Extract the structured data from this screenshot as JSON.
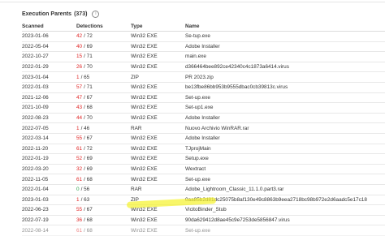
{
  "section": {
    "title": "Execution Parents",
    "count": "(373)",
    "info_icon": "info-icon"
  },
  "columns": {
    "scanned": "Scanned",
    "detections": "Detections",
    "type": "Type",
    "name": "Name"
  },
  "rows": [
    {
      "scanned": "2023-01-06",
      "det": "42",
      "total": "/ 72",
      "color": "red",
      "type": "Win32 EXE",
      "name": "Se-tup.exe"
    },
    {
      "scanned": "2022-05-04",
      "det": "40",
      "total": "/ 69",
      "color": "red",
      "type": "Win32 EXE",
      "name": "Adobe Installer"
    },
    {
      "scanned": "2022-10-27",
      "det": "15",
      "total": "/ 71",
      "color": "red",
      "type": "Win32 EXE",
      "name": "main.exe"
    },
    {
      "scanned": "2022-01-29",
      "det": "26",
      "total": "/ 70",
      "color": "red",
      "type": "Win32 EXE",
      "name": "d366464bee892ce42340c4c1873a6414.virus"
    },
    {
      "scanned": "2023-01-04",
      "det": "1",
      "total": "/ 65",
      "color": "red",
      "type": "ZIP",
      "name": "PR 2023.zip"
    },
    {
      "scanned": "2022-01-03",
      "det": "57",
      "total": "/ 71",
      "color": "red",
      "type": "Win32 EXE",
      "name": "be13fbe86bb953b9555dbac0cb39813c.virus"
    },
    {
      "scanned": "2021-12-06",
      "det": "47",
      "total": "/ 67",
      "color": "red",
      "type": "Win32 EXE",
      "name": "Set-up.exe"
    },
    {
      "scanned": "2021-10-09",
      "det": "43",
      "total": "/ 68",
      "color": "red",
      "type": "Win32 EXE",
      "name": "Set-up1.exe"
    },
    {
      "scanned": "2022-08-23",
      "det": "44",
      "total": "/ 70",
      "color": "red",
      "type": "Win32 EXE",
      "name": "Adobe Installer"
    },
    {
      "scanned": "2022-07-05",
      "det": "1",
      "total": "/ 46",
      "color": "red",
      "type": "RAR",
      "name": "Nuovo Archivio WinRAR.rar"
    },
    {
      "scanned": "2022-03-14",
      "det": "55",
      "total": "/ 67",
      "color": "red",
      "type": "Win32 EXE",
      "name": "Adobe Installer"
    },
    {
      "scanned": "2022-11-20",
      "det": "61",
      "total": "/ 72",
      "color": "red",
      "type": "Win32 EXE",
      "name": "TJprojMain"
    },
    {
      "scanned": "2022-01-19",
      "det": "52",
      "total": "/ 69",
      "color": "red",
      "type": "Win32 EXE",
      "name": "Setup.exe"
    },
    {
      "scanned": "2022-03-20",
      "det": "32",
      "total": "/ 69",
      "color": "red",
      "type": "Win32 EXE",
      "name": "Wextract"
    },
    {
      "scanned": "2022-11-05",
      "det": "61",
      "total": "/ 68",
      "color": "red",
      "type": "Win32 EXE",
      "name": "Set-up.exe"
    },
    {
      "scanned": "2022-01-04",
      "det": "0",
      "total": "/ 56",
      "color": "green",
      "type": "RAR",
      "name": "Adobe_Lightroom_Classic_11.1.0.part3.rar"
    },
    {
      "scanned": "2023-01-03",
      "det": "1",
      "total": "/ 63",
      "color": "red",
      "type": "ZIP",
      "name": "0aa85b2d81dc25075b8af130e49c8863b9eea2718bc98b972e2d6aadc5e17c18"
    },
    {
      "scanned": "2022-06-23",
      "det": "55",
      "total": "/ 67",
      "color": "red",
      "type": "Win32 EXE",
      "name": "VicitoBinder_Stub"
    },
    {
      "scanned": "2022-07-19",
      "det": "36",
      "total": "/ 68",
      "color": "red",
      "type": "Win32 EXE",
      "name": "90da629412d8ae45c9e7253de5856847.virus"
    },
    {
      "scanned": "2022-08-14",
      "det": "61",
      "total": "/ 68",
      "color": "red",
      "type": "Win32 EXE",
      "name": "Set-up.exe"
    }
  ],
  "colors": {
    "red": "#e02424",
    "green": "#2aa14b",
    "highlight": "#f5f22a"
  }
}
